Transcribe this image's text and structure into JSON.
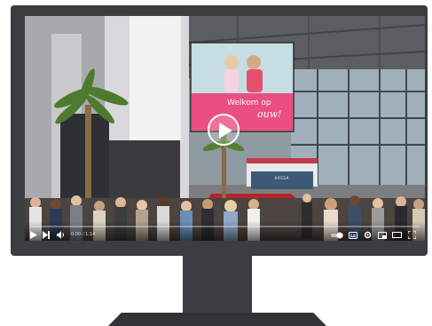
{
  "video": {
    "billboard_line1": "Welkom op",
    "billboard_line2": "ouw!",
    "sign_text": "KASSA",
    "time": "0:00 / 1:14",
    "progress": 0.0
  },
  "icons": {
    "play_overlay": "play-circle-icon",
    "controls": [
      "play-icon",
      "next-icon",
      "volume-icon",
      "autoplay-icon",
      "subtitles-icon",
      "settings-icon",
      "miniplayer-icon",
      "theater-icon",
      "fullscreen-icon"
    ]
  },
  "colors": {
    "bezel": "#3c3d40",
    "billboard_pink": "#e94f7f",
    "carpet_red": "#b3242b"
  }
}
